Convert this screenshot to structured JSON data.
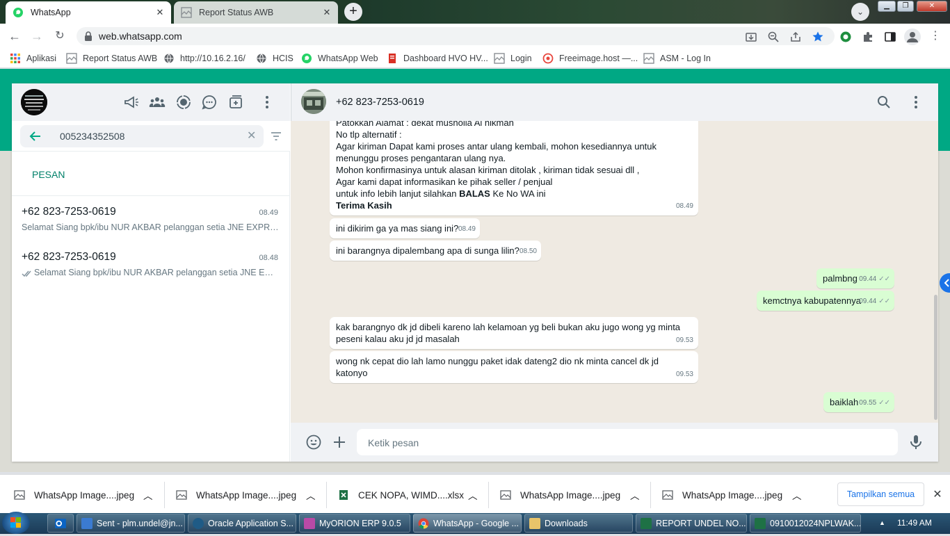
{
  "browser": {
    "tabs": [
      {
        "title": "WhatsApp",
        "active": true
      },
      {
        "title": "Report Status AWB",
        "active": false
      }
    ],
    "url": "web.whatsapp.com",
    "bookmarks": [
      "Aplikasi",
      "Report Status AWB",
      "http://10.16.2.16/",
      "HCIS",
      "WhatsApp Web",
      "Dashboard HVO HV...",
      "Login",
      "Freeimage.host —...",
      "ASM - Log In"
    ]
  },
  "left_pane": {
    "search_value": "005234352508",
    "section_label": "PESAN",
    "chats": [
      {
        "name": "+62 823-7253-0619",
        "time": "08.49",
        "preview": "Selamat Siang   bpk/ibu NUR AKBAR pelanggan setia JNE EXPRESS"
      },
      {
        "name": "+62 823-7253-0619",
        "time": "08.48",
        "preview": "Selamat Siang   bpk/ibu NUR AKBAR pelanggan setia JNE EXPRESS"
      }
    ]
  },
  "chat": {
    "contact": "+62 823-7253-0619",
    "first_message": {
      "lines": [
        "Patokkan Alamat : dekat musholla Al hikmah",
        "No tlp alternatif :",
        "Agar kiriman Dapat kami proses antar ulang kembali, mohon kesediannya untuk",
        "menunggu proses pengantaran ulang nya.",
        "Mohon konfirmasinya untuk alasan kiriman ditolak , kiriman tidak sesuai dll ,",
        "Agar kami dapat informasikan ke pihak seller / penjual"
      ],
      "line_balas_pre": "untuk info lebih lanjut silahkan ",
      "line_balas_bold": "BALAS",
      "line_balas_post": " Ke No WA ini",
      "thanks": "Terima Kasih",
      "time": "08.49"
    },
    "messages": [
      {
        "text": "ini dikirim ga ya mas siang ini?",
        "time": "08.49",
        "dir": "in"
      },
      {
        "text": "ini barangnya dipalembang apa di sunga lilin?",
        "time": "08.50",
        "dir": "in"
      },
      {
        "text": "palmbng",
        "time": "09.44",
        "dir": "out"
      },
      {
        "text": "kemctnya kabupatennya",
        "time": "09.44",
        "dir": "out"
      },
      {
        "text": "kak barangnyo dk jd dibeli kareno lah kelamoan yg beli bukan aku jugo wong yg minta",
        "text2": "peseni kalau aku jd jd masalah",
        "time": "09.53",
        "dir": "in"
      },
      {
        "text": "wong nk cepat dio lah lamo nunggu paket idak dateng2 dio nk minta cancel dk jd katonyo",
        "time": "09.53",
        "dir": "in"
      },
      {
        "text": "baiklah",
        "time": "09.55",
        "dir": "out"
      }
    ],
    "input_placeholder": "Ketik pesan"
  },
  "downloads": {
    "items": [
      "WhatsApp Image....jpeg",
      "WhatsApp Image....jpeg",
      "CEK NOPA, WIMD....xlsx",
      "WhatsApp Image....jpeg",
      "WhatsApp Image....jpeg"
    ],
    "show_all": "Tampilkan semua"
  },
  "taskbar": {
    "items": [
      "Sent - plm.undel@jn...",
      "Oracle Application S...",
      "MyORION ERP 9.0.5",
      "WhatsApp - Google ...",
      "Downloads",
      "REPORT UNDEL NO...",
      "0910012024NPLWAK..."
    ],
    "clock": "11:49 AM"
  }
}
